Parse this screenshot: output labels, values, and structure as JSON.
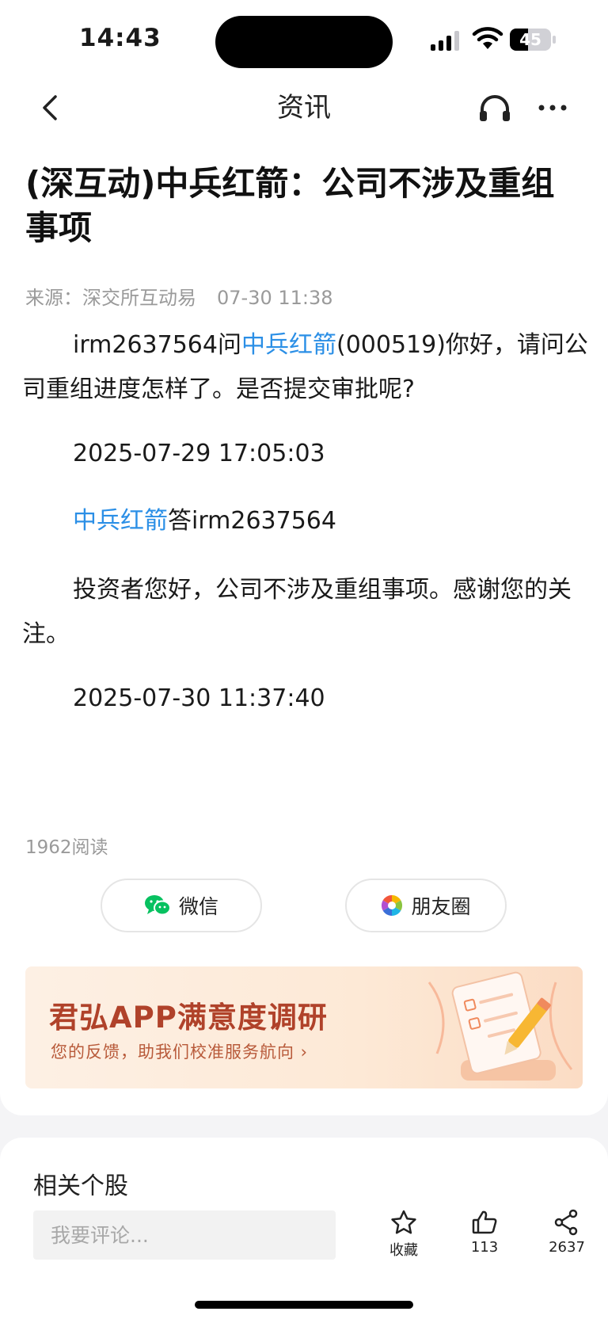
{
  "status_bar": {
    "time": "14:43",
    "battery": "45",
    "battery_level": 0.45
  },
  "nav": {
    "title": "资讯",
    "icons": [
      "chevron-left-icon",
      "headset-icon",
      "more-icon"
    ]
  },
  "article": {
    "headline": "(深互动)中兵红箭：公司不涉及重组事项",
    "source": "来源：深交所互动易",
    "time": "07-30 11:38",
    "question": {
      "asker": "irm2637564",
      "ask_word": "问",
      "company": "中兵红箭",
      "text": "(000519)你好，请问公司重组进度怎样了。是否提交审批呢?"
    },
    "question_time": "2025-07-29 17:05:03",
    "answer_header": {
      "company": "中兵红箭",
      "answer_word": "答",
      "asker": "irm2637564"
    },
    "answer_text": "投资者您好，公司不涉及重组事项。感谢您的关注。",
    "answer_time": "2025-07-30 11:37:40",
    "reads": "1962阅读",
    "share": {
      "wechat": "微信",
      "moments": "朋友圈"
    },
    "banner": {
      "title": "君弘APP满意度调研",
      "subtitle": "您的反馈，助我们校准服务航向"
    }
  },
  "bottom": {
    "related_title": "相关个股",
    "comment_placeholder": "我要评论...",
    "favorite_label": "收藏",
    "like_count": "113",
    "share_count": "2637"
  },
  "colors": {
    "link": "#2b8fe6",
    "wechat_green": "#07c160",
    "banner_text": "#b0422a"
  }
}
